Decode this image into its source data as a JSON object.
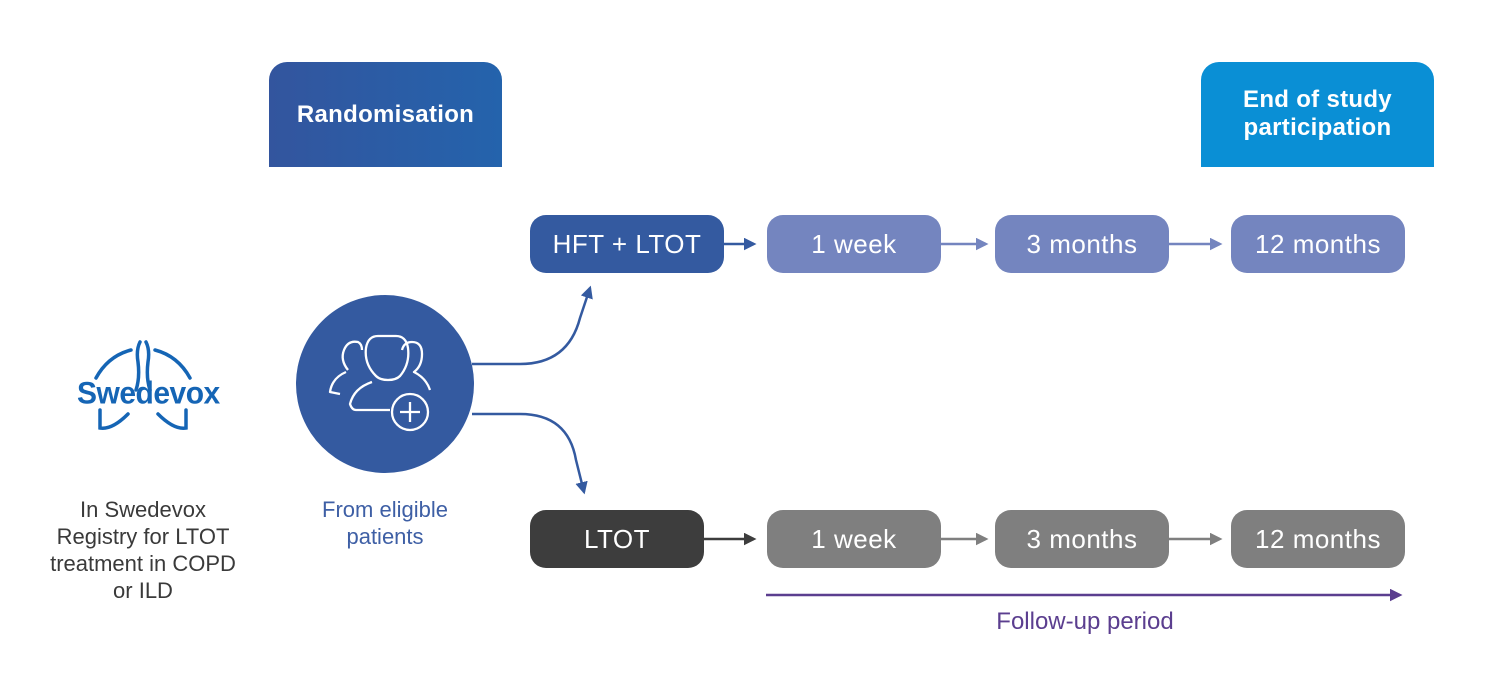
{
  "headers": {
    "randomisation": "Randomisation",
    "end_of_study_line1": "End of study",
    "end_of_study_line2": "participation"
  },
  "logo": {
    "text": "Swedevox",
    "icon": "lungs-icon"
  },
  "registry_caption": [
    "In Swedevox",
    "Registry for LTOT",
    "treatment in COPD",
    "or ILD"
  ],
  "randomisation_node": {
    "icon": "add-patients-icon",
    "caption": [
      "From eligible",
      "patients"
    ]
  },
  "arms": [
    {
      "label": "HFT + LTOT",
      "timepoints": [
        "1 week",
        "3 months",
        "12 months"
      ]
    },
    {
      "label": "LTOT",
      "timepoints": [
        "1 week",
        "3 months",
        "12 months"
      ]
    }
  ],
  "follow_up": {
    "label": "Follow-up period"
  },
  "colors": {
    "randomisation_header": "#2c5ca6",
    "end_header": "#0a8fd5",
    "arm_hft": "#345aa0",
    "arm_ltot": "#3d3d3d",
    "timepoint_hft": "#7485bf",
    "timepoint_ltot": "#7f7f7f",
    "follow_up": "#5b3e8f",
    "logo": "#1565b5"
  }
}
